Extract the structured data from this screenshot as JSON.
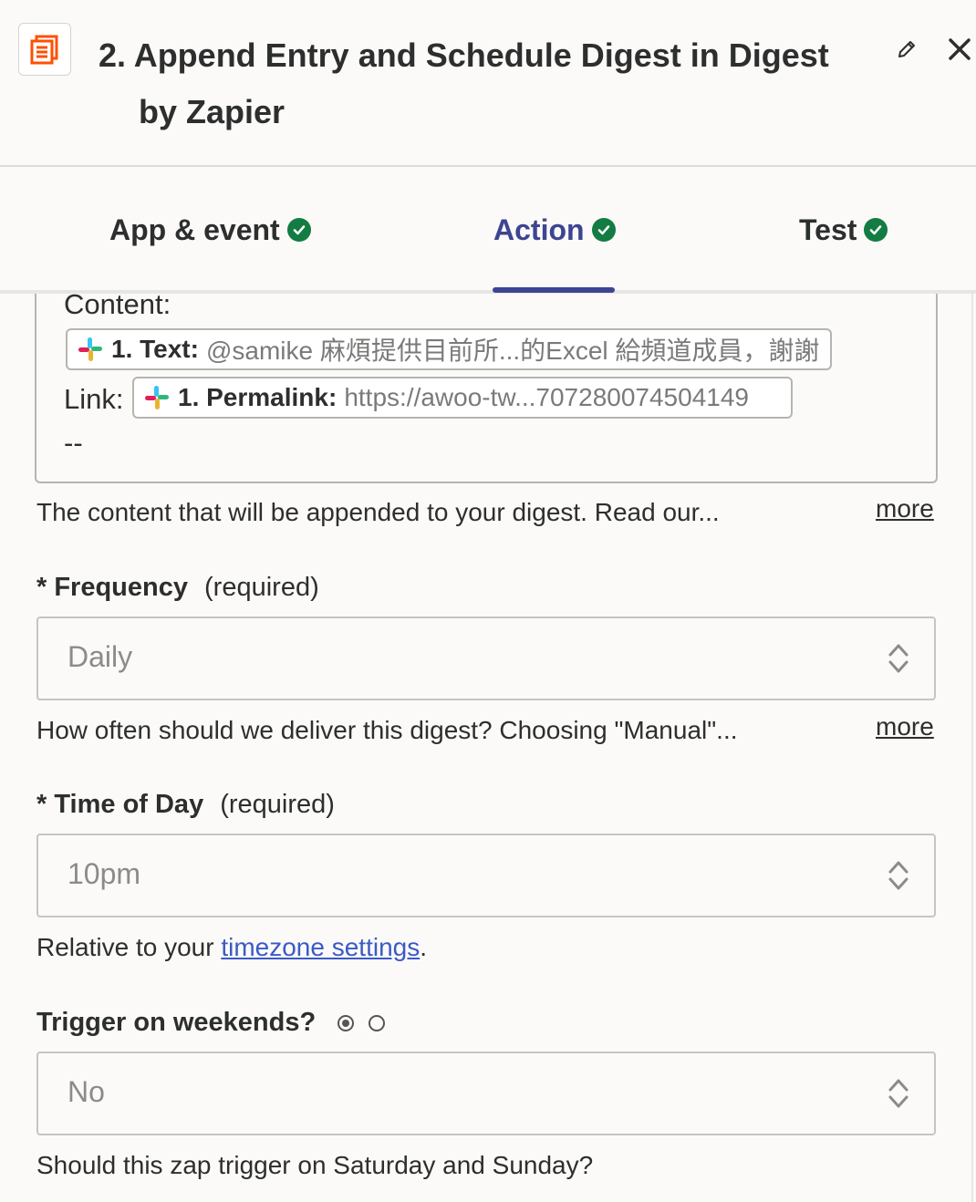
{
  "header": {
    "title_line1": "2. Append Entry and Schedule Digest in Digest",
    "title_line2": "by Zapier",
    "app_icon": "digest-icon",
    "accent": "#ff4f00"
  },
  "tabs": [
    {
      "label": "App & event",
      "status": "complete"
    },
    {
      "label": "Action",
      "status": "complete",
      "active": true
    },
    {
      "label": "Test",
      "status": "complete"
    }
  ],
  "content": {
    "label": "Content:",
    "text_pill": {
      "key": "1. Text:",
      "value": "@samike 麻煩提供目前所...的Excel 給頻道成員，謝謝"
    },
    "link_label": "Link:",
    "link_pill": {
      "key": "1. Permalink:",
      "value": "https://awoo-tw...707280074504149"
    },
    "separator": "--",
    "help": "The content that will be appended to your digest. Read our...",
    "more": "more"
  },
  "frequency": {
    "label": "Frequency",
    "required": "(required)",
    "value": "Daily",
    "help": "How often should we deliver this digest? Choosing \"Manual\"...",
    "more": "more"
  },
  "time_of_day": {
    "label": "Time of Day",
    "required": "(required)",
    "value": "10pm",
    "help_prefix": "Relative to your ",
    "help_link": "timezone settings",
    "help_suffix": "."
  },
  "weekends": {
    "label": "Trigger on weekends?",
    "value": "No",
    "help": "Should this zap trigger on Saturday and Sunday?"
  },
  "colors": {
    "active_tab": "#3d4592",
    "check": "#137c43",
    "link": "#3b5ac7"
  }
}
